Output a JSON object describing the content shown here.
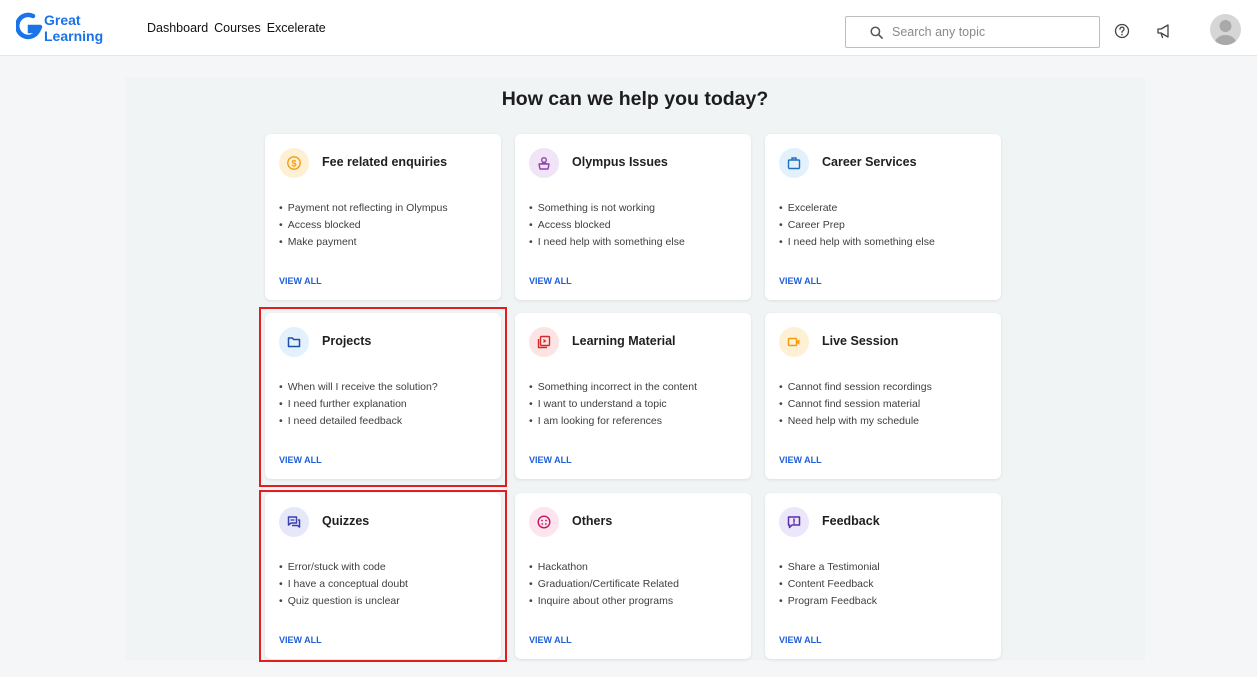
{
  "brand": {
    "logo_line1": "Great",
    "logo_line2": "Learning",
    "logo_color": "#1a73e8"
  },
  "nav": {
    "items": [
      "Dashboard",
      "Courses",
      "Excelerate"
    ]
  },
  "search": {
    "placeholder": "Search any topic"
  },
  "header_icons": [
    "help-circle-icon",
    "megaphone-icon",
    "user-avatar"
  ],
  "page": {
    "heading": "How can we help you today?"
  },
  "view_all_label": "VIEW ALL",
  "cards": [
    {
      "title": "Fee related enquiries",
      "icon": "dollar-circle-icon",
      "icon_bg": "#fdf0d5",
      "icon_color": "#f39c12",
      "items": [
        "Payment not reflecting in Olympus",
        "Access blocked",
        "Make payment"
      ]
    },
    {
      "title": "Olympus Issues",
      "icon": "user-laptop-icon",
      "icon_bg": "#f1e4f7",
      "icon_color": "#8e44ad",
      "items": [
        "Something is not working",
        "Access blocked",
        "I need help with something else"
      ]
    },
    {
      "title": "Career Services",
      "icon": "briefcase-icon",
      "icon_bg": "#e2f1fb",
      "icon_color": "#1f6fc2",
      "items": [
        "Excelerate",
        "Career Prep",
        "I need help with something else"
      ]
    },
    {
      "title": "Projects",
      "icon": "folder-icon",
      "icon_bg": "#e2f1fb",
      "icon_color": "#1f4fa8",
      "items": [
        "When will I receive the solution?",
        "I need further explanation",
        "I need detailed feedback"
      ]
    },
    {
      "title": "Learning Material",
      "icon": "document-stack-icon",
      "icon_bg": "#fde4e4",
      "icon_color": "#d62828",
      "items": [
        "Something incorrect in the content",
        "I want to understand a topic",
        "I am looking for references"
      ]
    },
    {
      "title": "Live Session",
      "icon": "video-camera-icon",
      "icon_bg": "#fdf0d5",
      "icon_color": "#f39c12",
      "items": [
        "Cannot find session recordings",
        "Cannot find session material",
        "Need help with my schedule"
      ]
    },
    {
      "title": "Quizzes",
      "icon": "chat-bubbles-icon",
      "icon_bg": "#e6e8fa",
      "icon_color": "#3a3fb0",
      "items": [
        "Error/stuck with code",
        "I have a conceptual doubt",
        "Quiz question is unclear"
      ]
    },
    {
      "title": "Others",
      "icon": "palette-icon",
      "icon_bg": "#fde4ee",
      "icon_color": "#c2185b",
      "items": [
        "Hackathon",
        "Graduation/Certificate Related",
        "Inquire about other programs"
      ]
    },
    {
      "title": "Feedback",
      "icon": "message-alert-icon",
      "icon_bg": "#ece6fa",
      "icon_color": "#5b2fb0",
      "items": [
        "Share a Testimonial",
        "Content Feedback",
        "Program Feedback"
      ]
    }
  ],
  "highlight_color": "#e02020"
}
